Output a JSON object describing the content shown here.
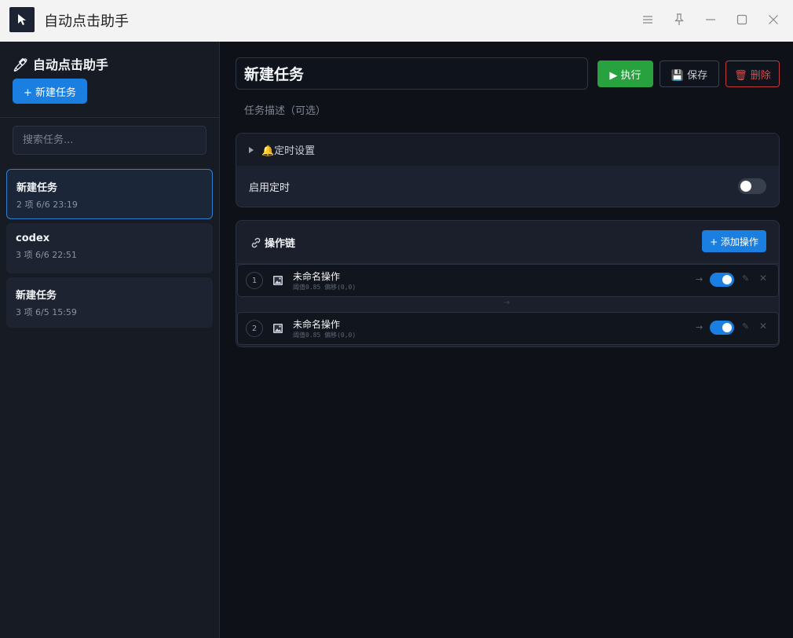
{
  "window": {
    "title": "自动点击助手",
    "logo_icon": "cursor-arrow-icon",
    "controls": [
      "menu-icon",
      "pin-icon",
      "minimize-icon",
      "maximize-icon",
      "close-icon"
    ]
  },
  "sidebar": {
    "title": "🖊 自动点击助手",
    "new_task_label": "+ 新建任务",
    "search_placeholder": "搜索任务...",
    "tasks": [
      {
        "name": "新建任务",
        "meta": "2 项  6/6 23:19",
        "active": true
      },
      {
        "name": "codex",
        "meta": "3 项  6/6 22:51",
        "active": false
      },
      {
        "name": "新建任务",
        "meta": "3 项  6/5 15:59",
        "active": false
      }
    ]
  },
  "main": {
    "task_title": "新建任务",
    "run_label": "▶ 执行",
    "save_label": "💾 保存",
    "delete_label": "🗑 删除",
    "description_placeholder": "任务描述（可选）"
  },
  "schedule": {
    "header_label": "🔔定时设置",
    "enable_label": "启用定时",
    "enabled": false
  },
  "chain": {
    "title": "操作链",
    "add_label": "+ 添加操作",
    "link_arrow": "→",
    "ops": [
      {
        "index": "1",
        "name": "未命名操作",
        "detail": "阈值0.85 偏移(0,0)",
        "enabled": true,
        "arrow": "→"
      },
      {
        "index": "2",
        "name": "未命名操作",
        "detail": "阈值0.85 偏移(0,0)",
        "enabled": true,
        "arrow": "→"
      }
    ]
  },
  "colors": {
    "accent": "#1a7fe0",
    "run": "#27a23f",
    "danger": "#c0393b",
    "background": "#0e1117",
    "sidebar": "#161b24"
  }
}
